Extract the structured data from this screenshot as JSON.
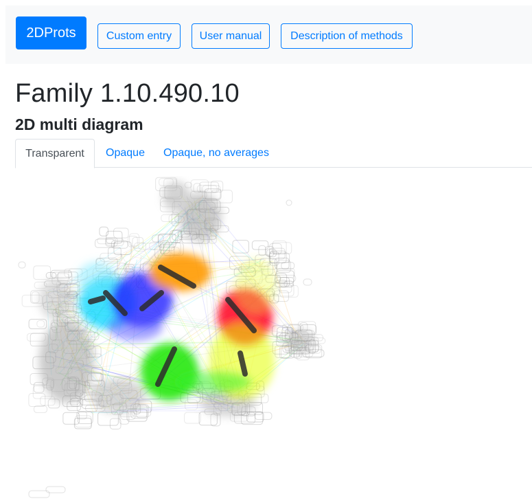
{
  "navbar": {
    "brand": "2DProts",
    "buttons": {
      "custom_entry": "Custom entry",
      "user_manual": "User manual",
      "description": "Description of methods"
    }
  },
  "page": {
    "title": "Family 1.10.490.10",
    "subtitle": "2D multi diagram"
  },
  "tabs": {
    "transparent": "Transparent",
    "opaque": "Opaque",
    "opaque_no_averages": "Opaque, no averages"
  },
  "diagram": {
    "colors": {
      "grey": "#9e9e9e",
      "cyan": "#00d5ff",
      "blue": "#1f1fff",
      "orange": "#ff9a00",
      "red": "#ff0022",
      "yellow": "#e4ff00",
      "green": "#14e600",
      "dark_segment": "#2c2c2c"
    }
  }
}
